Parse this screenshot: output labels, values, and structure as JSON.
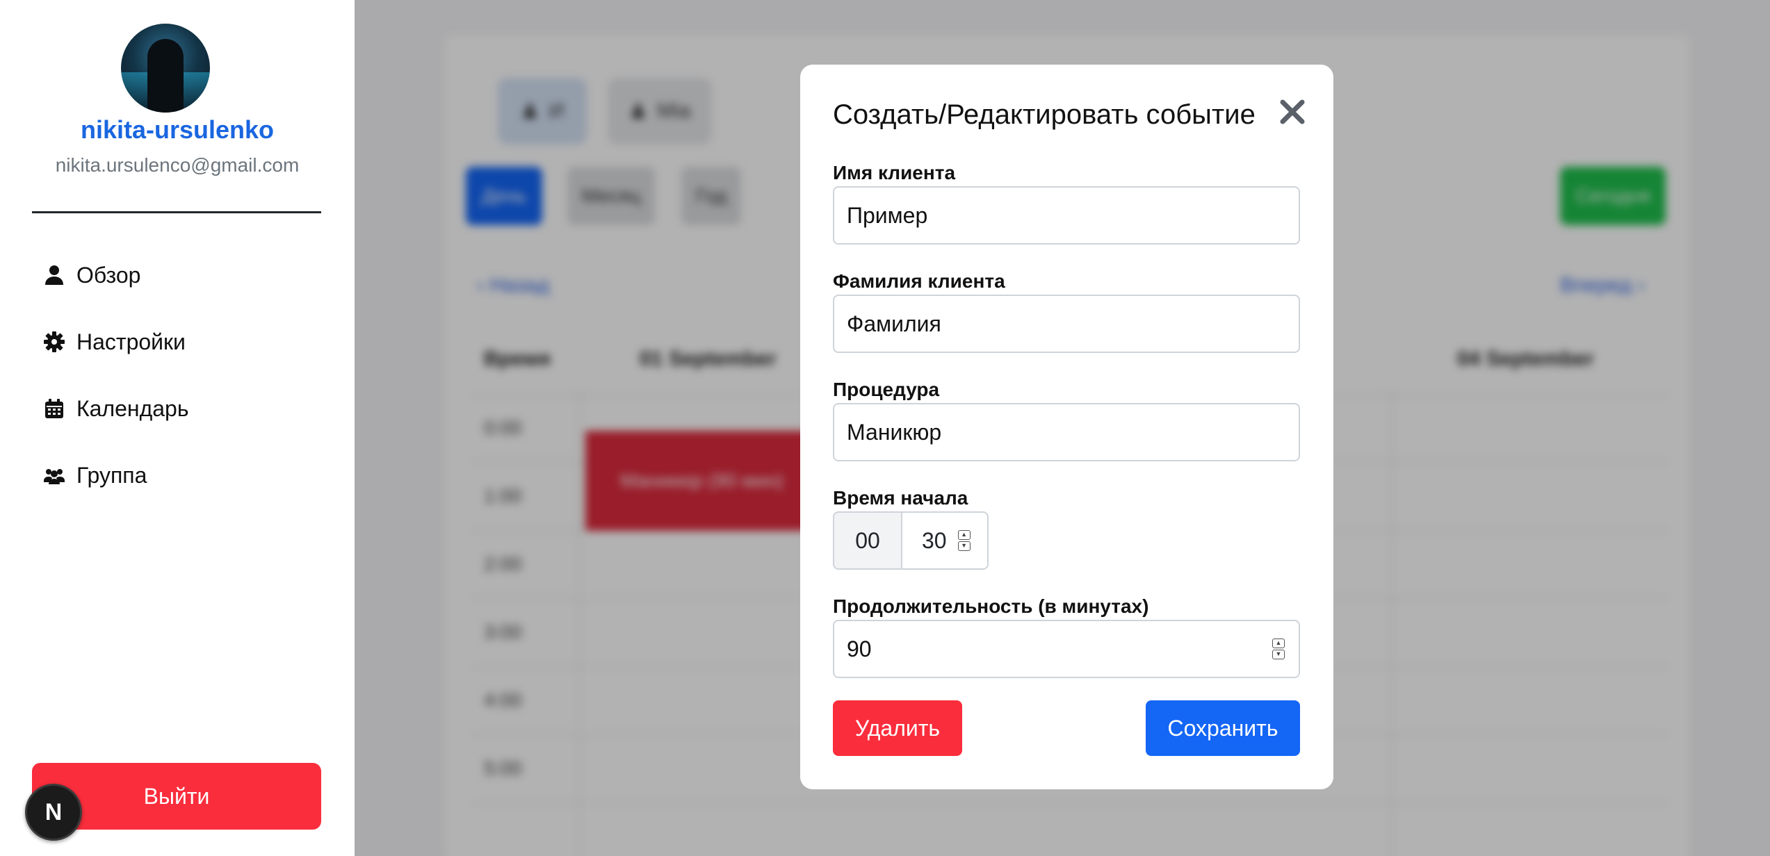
{
  "sidebar": {
    "username": "nikita-ursulenko",
    "email": "nikita.ursulenco@gmail.com",
    "nav": [
      {
        "label": "Обзор",
        "icon": "user-icon"
      },
      {
        "label": "Настройки",
        "icon": "gear-icon"
      },
      {
        "label": "Календарь",
        "icon": "calendar-icon"
      },
      {
        "label": "Группа",
        "icon": "users-gear-icon"
      }
    ],
    "logout_label": "Выйти",
    "dev_badge": "N"
  },
  "background": {
    "users": [
      "И",
      "Мia"
    ],
    "views": [
      "День",
      "Месяц",
      "Год"
    ],
    "today_label": "Сегодня",
    "prev_label": "‹ Назад",
    "next_label": "Вперед ›",
    "table_headers": [
      "Время",
      "01 September",
      "04 September"
    ],
    "times": [
      "0:00",
      "1:00",
      "2:00",
      "3:00",
      "4:00",
      "5:00"
    ],
    "event_label": "Маникюр (90 мин)"
  },
  "modal": {
    "title": "Создать/Редактировать событие",
    "first_name_label": "Имя клиента",
    "first_name_value": "Пример",
    "last_name_label": "Фамилия клиента",
    "last_name_value": "Фамилия",
    "procedure_label": "Процедура",
    "procedure_value": "Маникюр",
    "start_time_label": "Время начала",
    "start_hour": "00",
    "start_minute": "30",
    "duration_label": "Продолжительность (в минутах)",
    "duration_value": "90",
    "delete_label": "Удалить",
    "save_label": "Сохранить"
  },
  "colors": {
    "accent_blue": "#1466f5",
    "danger_red": "#fa2d3c",
    "success_green": "#1fbf4c"
  }
}
